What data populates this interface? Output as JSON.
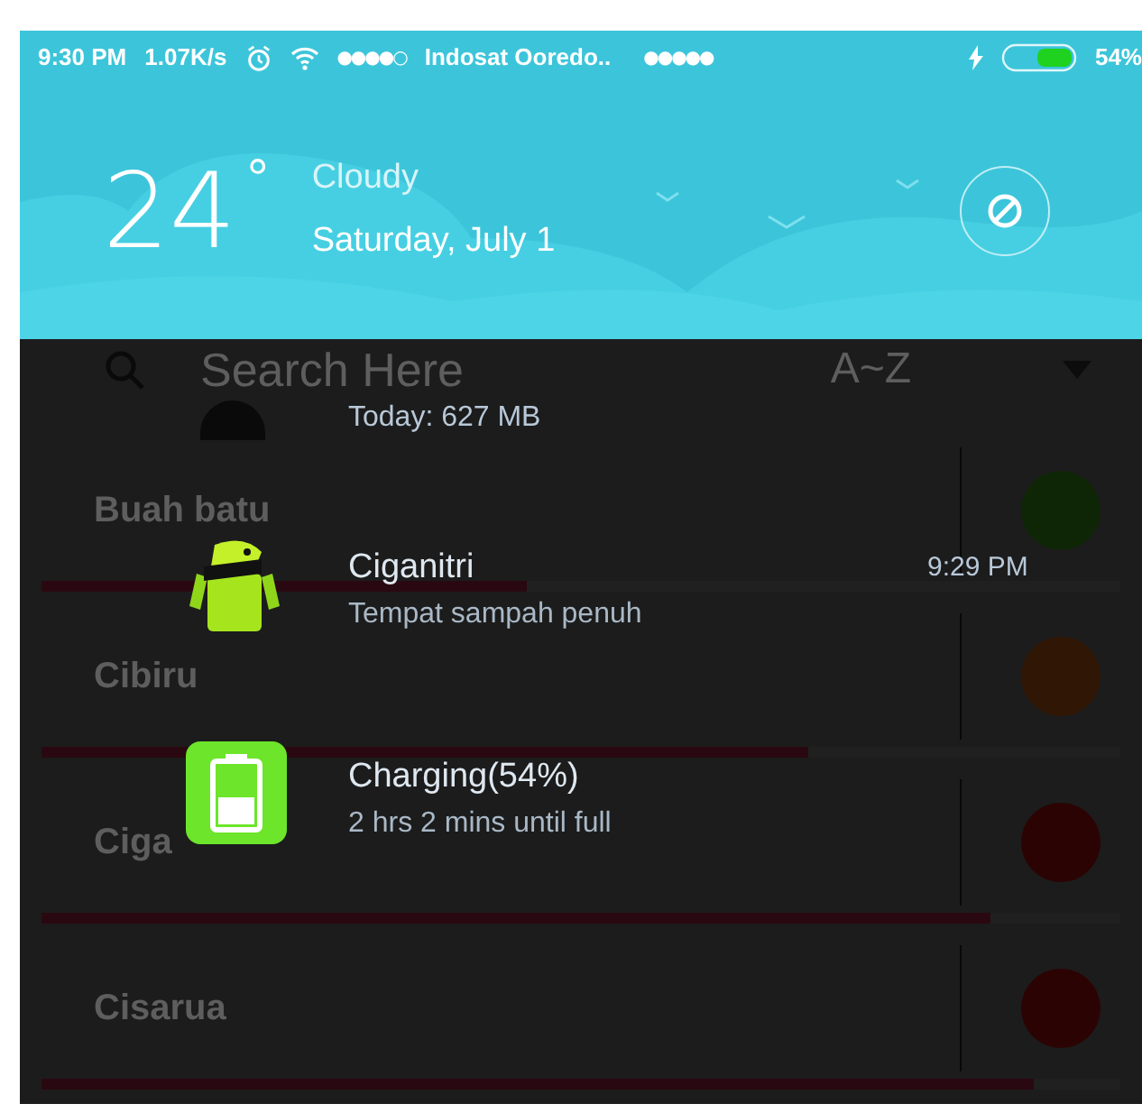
{
  "status_bar": {
    "time": "9:30 PM",
    "speed": "1.07K/s",
    "signal_1": "●●●●○",
    "carrier": "Indosat Ooredo..",
    "signal_2": "●●●●●",
    "battery": "54%"
  },
  "weather": {
    "temperature": "24",
    "degree": "°",
    "condition": "Cloudy",
    "date": "Saturday, July 1"
  },
  "app": {
    "search": {
      "placeholder": "Search Here"
    },
    "sort": "A~Z",
    "rows": [
      {
        "name": "Buah batu",
        "level": 0.45,
        "color": "#0f2606"
      },
      {
        "name": "Cibiru",
        "level": 0.71,
        "color": "#301605"
      },
      {
        "name": "Ciga",
        "level": 0.88,
        "color": "#2c0303"
      },
      {
        "name": "Cisarua",
        "level": 0.92,
        "color": "#2c0303"
      }
    ]
  },
  "notifications": [
    {
      "kind": "data",
      "title": "Today: 627 MB"
    },
    {
      "kind": "message",
      "title": "Ciganitri",
      "text": "Tempat sampah penuh",
      "time": "9:29 PM"
    },
    {
      "kind": "battery",
      "title": "Charging(54%)",
      "text": "2 hrs 2 mins until full"
    }
  ]
}
